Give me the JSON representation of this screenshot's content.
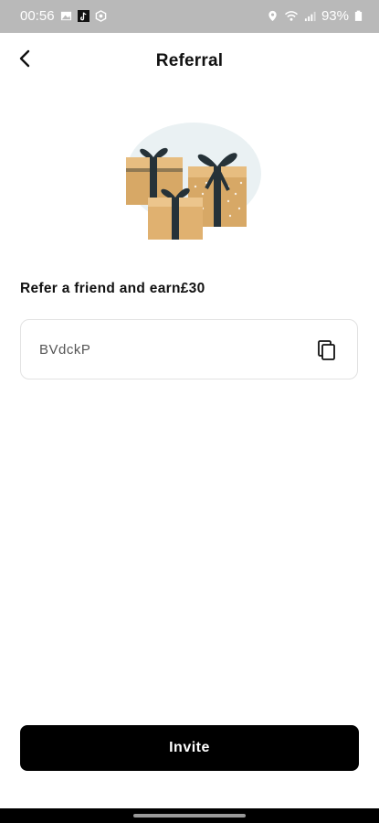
{
  "status_bar": {
    "time": "00:56",
    "battery": "93%",
    "icons": [
      "image-icon",
      "tiktok-icon",
      "settings-hex-icon",
      "location-icon",
      "wifi-icon",
      "signal-icon",
      "battery-icon"
    ]
  },
  "header": {
    "title": "Referral",
    "back_icon": "chevron-left-icon"
  },
  "illustration": "gift-boxes-icon",
  "referral": {
    "text": "Refer a friend and earn£30",
    "code": "BVdckP",
    "copy_icon": "copy-icon"
  },
  "invite_button": {
    "label": "Invite"
  },
  "colors": {
    "status_bar_bg": "#b9b9b9",
    "primary_button": "#000000",
    "gift_box": "#d7a866",
    "ribbon": "#263238",
    "border": "#e2e2e2"
  }
}
